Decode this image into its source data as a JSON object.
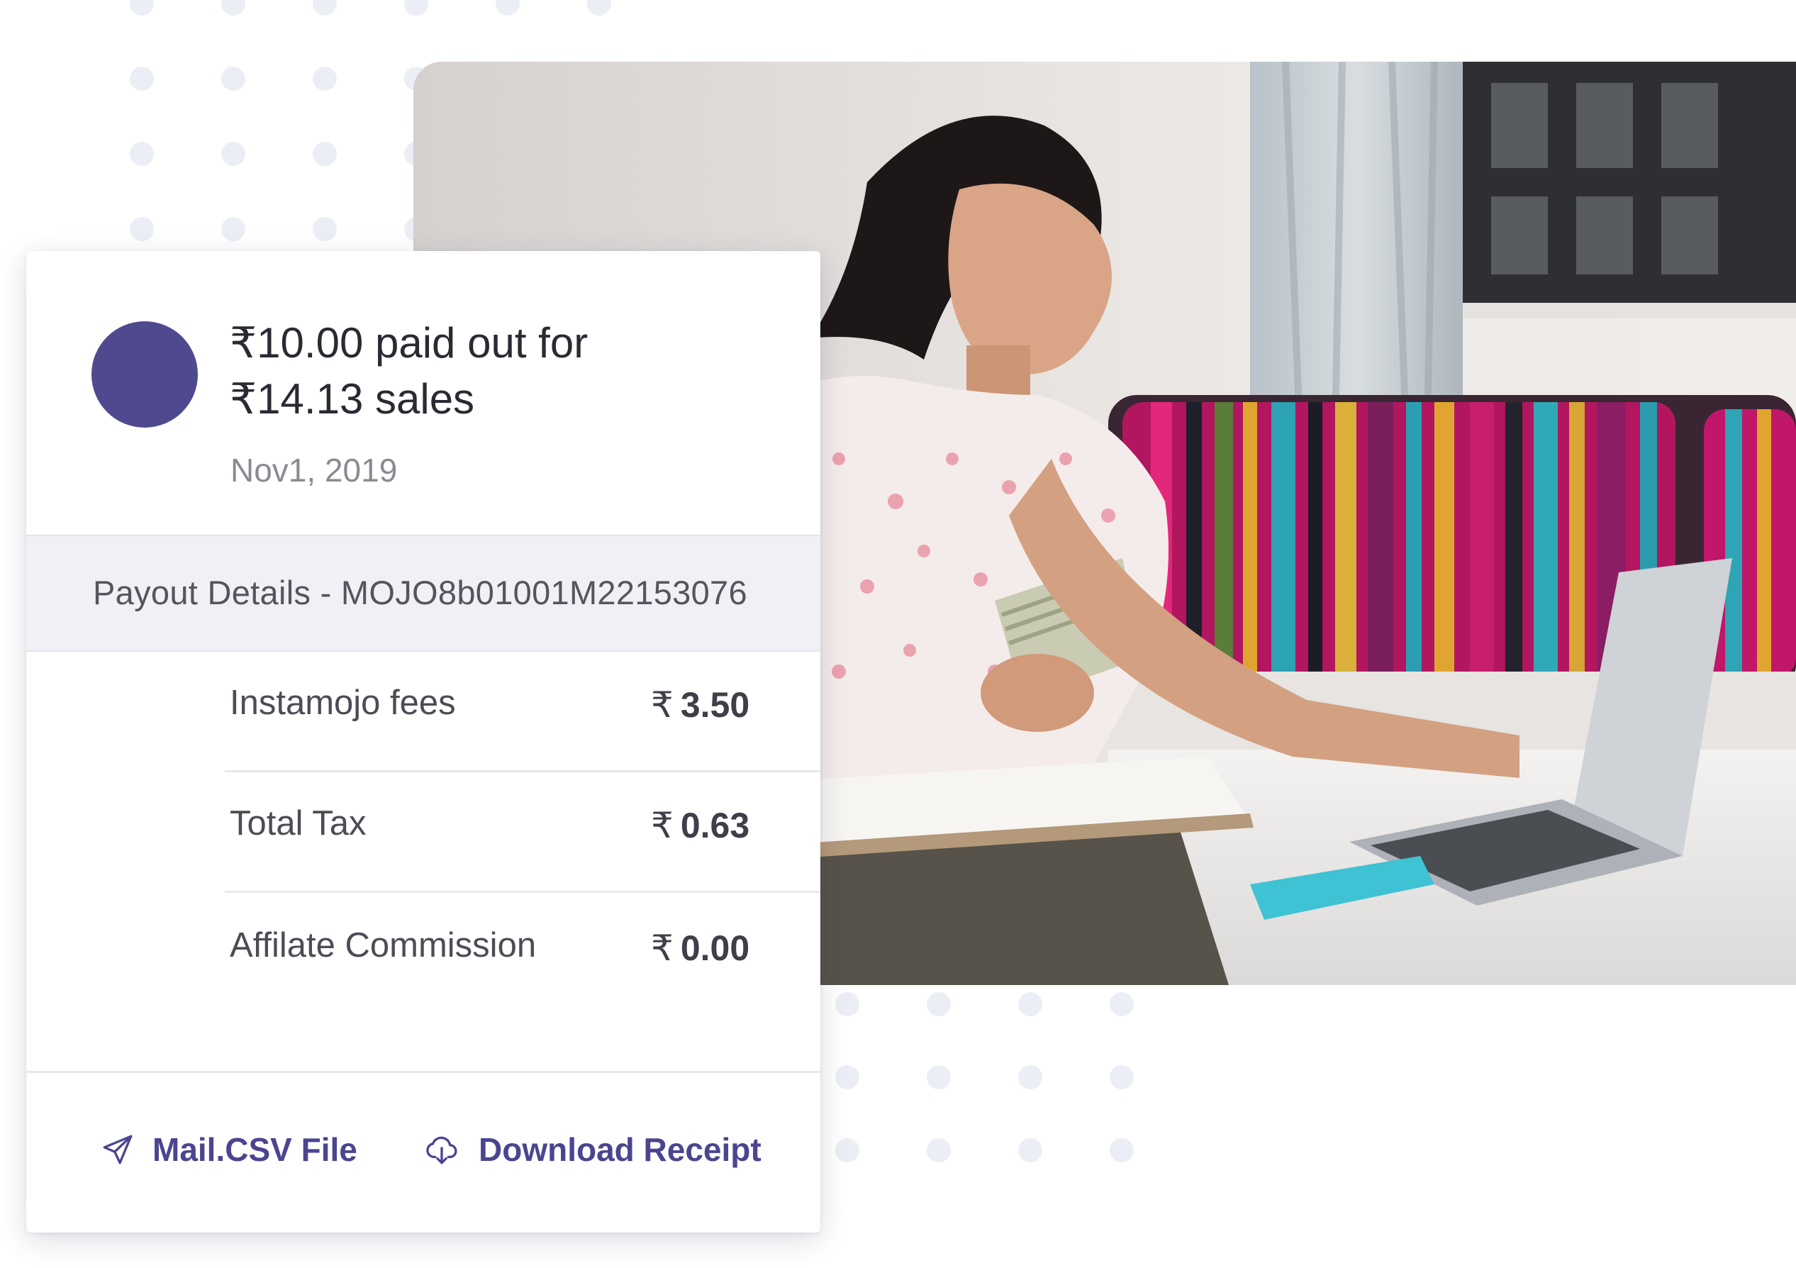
{
  "colors": {
    "brand": "#4f4a8f",
    "link": "#4b4590",
    "band": "#f0f0f5",
    "dots": "#eceef6"
  },
  "summary": {
    "line1": "₹10.00 paid out for",
    "line2": "₹14.13 sales",
    "date": "Nov1, 2019"
  },
  "details": {
    "heading": "Payout Details - MOJO8b01001M22153076"
  },
  "breakdown": [
    {
      "label": "Instamojo fees",
      "currency": "₹",
      "amount": "3.50"
    },
    {
      "label": "Total Tax",
      "currency": "₹",
      "amount": "0.63"
    },
    {
      "label": "Affilate Commission",
      "currency": "₹",
      "amount": "0.00"
    }
  ],
  "actions": {
    "mail": {
      "label": "Mail.CSV File",
      "icon": "send-icon"
    },
    "download": {
      "label": "Download Receipt",
      "icon": "cloud-download-icon"
    }
  }
}
